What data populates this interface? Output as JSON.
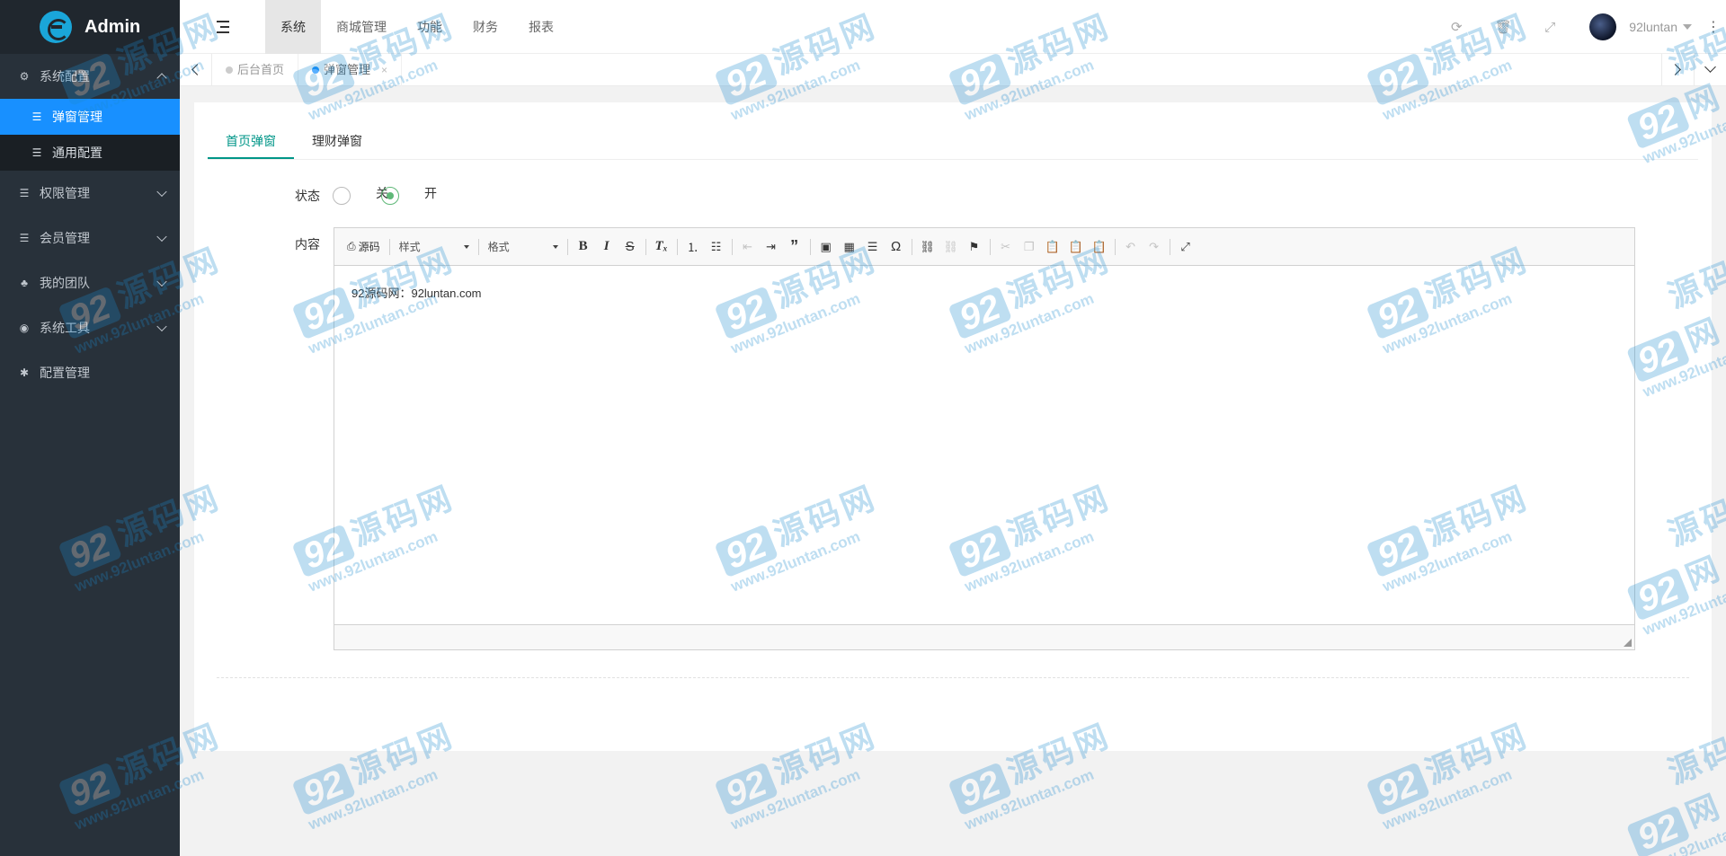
{
  "app": {
    "title": "Admin"
  },
  "sidebar": {
    "groups": [
      {
        "label": "系统配置",
        "icon": "gears-icon",
        "open": true,
        "children": [
          {
            "label": "弹窗管理",
            "active": true
          },
          {
            "label": "通用配置",
            "active": false
          }
        ]
      },
      {
        "label": "权限管理",
        "icon": "list-icon"
      },
      {
        "label": "会员管理",
        "icon": "list-icon"
      },
      {
        "label": "我的团队",
        "icon": "sitemap-icon"
      },
      {
        "label": "系统工具",
        "icon": "dashboard-icon"
      },
      {
        "label": "配置管理",
        "icon": "asterisk-icon"
      }
    ]
  },
  "header": {
    "nav": [
      "系统",
      "商城管理",
      "功能",
      "财务",
      "报表"
    ],
    "active_nav": "系统",
    "username": "92luntan"
  },
  "tabs": [
    {
      "label": "后台首页",
      "active": false
    },
    {
      "label": "弹窗管理",
      "active": true,
      "close": "×"
    }
  ],
  "form": {
    "tabs": [
      "首页弹窗",
      "理财弹窗"
    ],
    "status_label": "状态",
    "status_options": [
      "关",
      "开"
    ],
    "status_value": "开",
    "content_label": "内容",
    "editor": {
      "source_label": "源码",
      "style_label": "样式",
      "format_label": "格式",
      "content": "92源码网：92luntan.com"
    }
  },
  "watermark": {
    "number": "92",
    "name": "源码网",
    "url": "www.92luntan.com"
  },
  "colors": {
    "accent": "#009688",
    "active_menu": "#1890ff",
    "sidebar": "#28313a",
    "radio": "#5fb878"
  }
}
